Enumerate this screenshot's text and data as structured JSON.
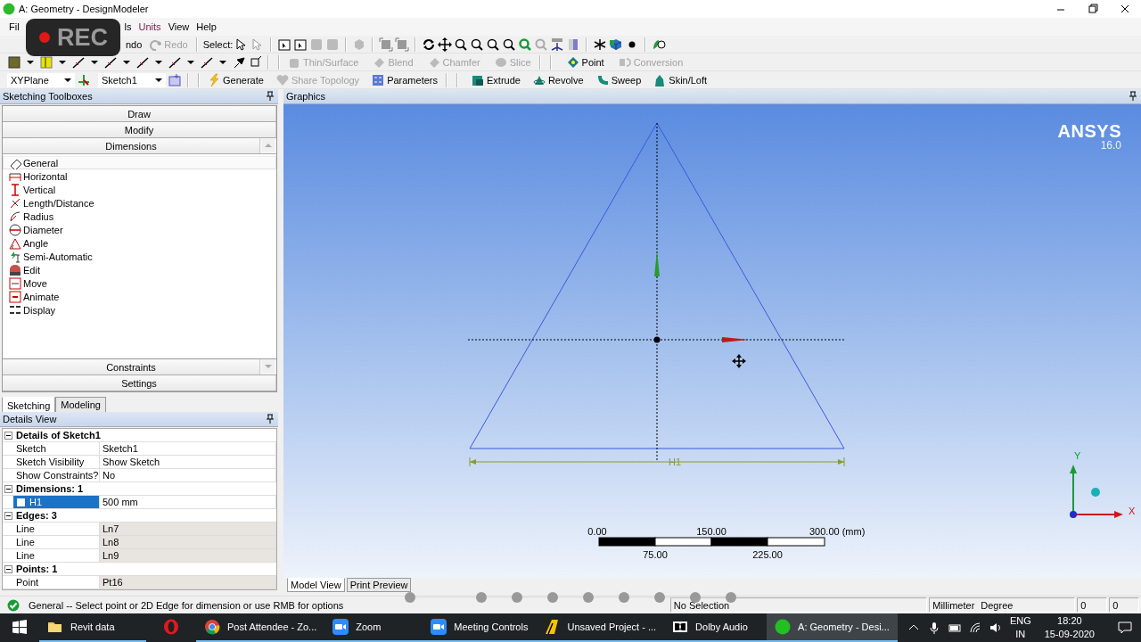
{
  "window": {
    "title": "A: Geometry - DesignModeler"
  },
  "recording": {
    "label": "REC"
  },
  "menu": [
    "Fil",
    "ls",
    "Units",
    "View",
    "Help"
  ],
  "toolbar_1": {
    "buttons": [
      {
        "label": "ndo",
        "disabled": false
      },
      {
        "label": "Redo",
        "disabled": true
      }
    ],
    "select_label": "Select:"
  },
  "toolbar_2": {
    "buttons": [
      {
        "label": "Thin/Surface",
        "disabled": true
      },
      {
        "label": "Blend",
        "disabled": true
      },
      {
        "label": "Chamfer",
        "disabled": true
      },
      {
        "label": "Slice",
        "disabled": true
      },
      {
        "label": "Point",
        "disabled": false
      },
      {
        "label": "Conversion",
        "disabled": true
      }
    ]
  },
  "toolbar_3": {
    "plane": "XYPlane",
    "sketch": "Sketch1",
    "buttons": [
      {
        "label": "Generate",
        "disabled": false
      },
      {
        "label": "Share Topology",
        "disabled": true
      },
      {
        "label": "Parameters",
        "disabled": false
      },
      {
        "label": "Extrude",
        "disabled": false
      },
      {
        "label": "Revolve",
        "disabled": false
      },
      {
        "label": "Sweep",
        "disabled": false
      },
      {
        "label": "Skin/Loft",
        "disabled": false
      }
    ]
  },
  "toolbox": {
    "title": "Sketching Toolboxes",
    "sections_top": [
      "Draw",
      "Modify",
      "Dimensions"
    ],
    "items": [
      {
        "label": "General",
        "selected": true
      },
      {
        "label": "Horizontal",
        "selected": false
      },
      {
        "label": "Vertical",
        "selected": false
      },
      {
        "label": "Length/Distance",
        "selected": false
      },
      {
        "label": "Radius",
        "selected": false
      },
      {
        "label": "Diameter",
        "selected": false
      },
      {
        "label": "Angle",
        "selected": false
      },
      {
        "label": "Semi-Automatic",
        "selected": false
      },
      {
        "label": "Edit",
        "selected": false
      },
      {
        "label": "Move",
        "selected": false
      },
      {
        "label": "Animate",
        "selected": false
      },
      {
        "label": "Display",
        "selected": false
      }
    ],
    "sections_bottom": [
      "Constraints",
      "Settings"
    ],
    "tabs": [
      {
        "label": "Sketching",
        "selected": true
      },
      {
        "label": "Modeling",
        "selected": false
      }
    ]
  },
  "details": {
    "title": "Details View",
    "groups": [
      {
        "title": "Details of Sketch1",
        "rows": [
          {
            "name": "Sketch",
            "value": "Sketch1",
            "selected": false,
            "readonly": false
          },
          {
            "name": "Sketch Visibility",
            "value": "Show Sketch",
            "selected": false,
            "readonly": false
          },
          {
            "name": "Show Constraints?",
            "value": "No",
            "selected": false,
            "readonly": false
          }
        ]
      },
      {
        "title": "Dimensions: 1",
        "rows": [
          {
            "name": "H1",
            "value": "500 mm",
            "selected": true,
            "readonly": false
          }
        ]
      },
      {
        "title": "Edges: 3",
        "rows": [
          {
            "name": "Line",
            "value": "Ln7",
            "selected": false,
            "readonly": true
          },
          {
            "name": "Line",
            "value": "Ln8",
            "selected": false,
            "readonly": true
          },
          {
            "name": "Line",
            "value": "Ln9",
            "selected": false,
            "readonly": true
          }
        ]
      },
      {
        "title": "Points: 1",
        "rows": [
          {
            "name": "Point",
            "value": "Pt16",
            "selected": false,
            "readonly": true
          }
        ]
      }
    ]
  },
  "graphics": {
    "title": "Graphics",
    "logo": "ANSYS",
    "version": "16.0",
    "dimension_label": "H1",
    "scale": {
      "top_labels": [
        "0.00",
        "150.00",
        "300.00 (mm)"
      ],
      "bottom_labels": [
        "75.00",
        "225.00"
      ]
    },
    "axes": {
      "y": "Y",
      "x": "X"
    },
    "view_tabs": [
      {
        "label": "Model View",
        "selected": true
      },
      {
        "label": "Print Preview",
        "selected": false
      }
    ]
  },
  "status_bar": {
    "message": "General -- Select point or 2D Edge for dimension or use RMB for options",
    "selection": "No Selection",
    "length_unit": "Millimeter",
    "angle_unit": "Degree",
    "field_1": "0",
    "field_2": "0"
  },
  "taskbar": {
    "items": [
      {
        "label": "Revit data",
        "running": true,
        "active": false
      },
      {
        "running": false,
        "active": false
      },
      {
        "label": "Post Attendee - Zo...",
        "running": true,
        "active": false
      },
      {
        "label": "Zoom",
        "running": true,
        "active": false
      },
      {
        "label": "Meeting Controls",
        "running": true,
        "active": false
      },
      {
        "label": "Unsaved Project - ...",
        "running": true,
        "active": false
      },
      {
        "label": "Dolby Audio",
        "running": true,
        "active": false
      },
      {
        "label": "A: Geometry - Desi...",
        "running": true,
        "active": true
      }
    ],
    "language": "ENG",
    "region": "IN",
    "time": "18:20",
    "date": "15-09-2020"
  }
}
